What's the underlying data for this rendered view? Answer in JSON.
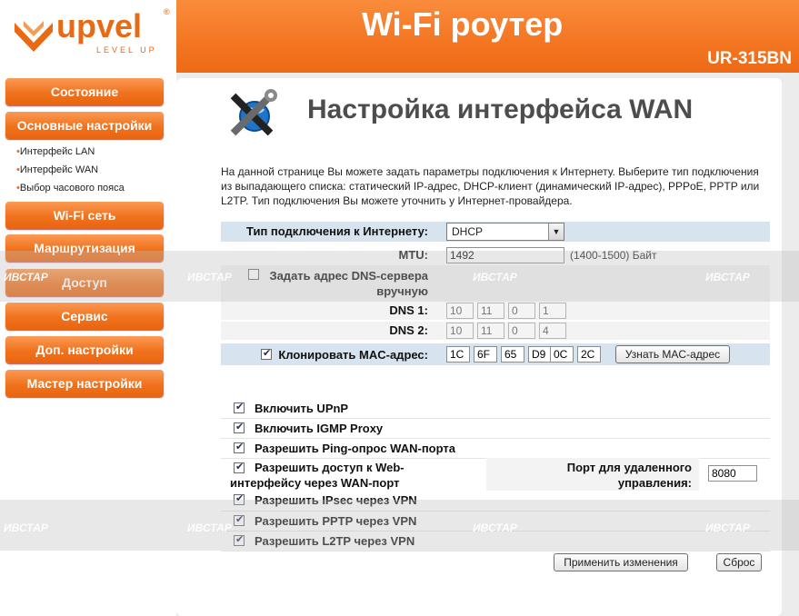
{
  "brand": {
    "name": "upvel",
    "tagline": "LEVEL UP",
    "reg": "®",
    "color": "#e86a14"
  },
  "header": {
    "title": "Wi-Fi роутер",
    "model": "UR-315BN",
    "color": "#f37521"
  },
  "sidebar": {
    "items": [
      {
        "label": "Состояние"
      },
      {
        "label": "Основные настройки"
      },
      {
        "label": "Wi-Fi сеть"
      },
      {
        "label": "Маршрутизация"
      },
      {
        "label": "Доступ"
      },
      {
        "label": "Сервис"
      },
      {
        "label": "Доп. настройки"
      },
      {
        "label": "Мастер настройки"
      }
    ],
    "subitems": [
      {
        "bullet": "•",
        "label": "Интерфейс LAN"
      },
      {
        "bullet": "•",
        "label": "Интерфейс WAN"
      },
      {
        "bullet": "•",
        "label": "Выбор часового пояса"
      }
    ]
  },
  "page": {
    "title": "Настройка интерфейса WAN",
    "icon": "tools-globe-icon",
    "description": "На данной странице Вы можете задать параметры подключения к Интернету. Выберите тип подключения из выпадающего списка: статический IP-адрес, DHCP-клиент (динамический IP-адрес), PPPoE, PPTP или L2TP. Тип подключения Вы можете уточнить у Интернет-провайдера."
  },
  "form": {
    "conn_type_label": "Тип подключения к Интернету:",
    "conn_type_value": "DHCP",
    "mtu_label": "MTU:",
    "mtu_value": "1492",
    "mtu_hint": "(1400-1500) Байт",
    "dns_manual_label": "Задать адрес DNS-сервера вручную",
    "dns_manual_checked": false,
    "dns1_label": "DNS 1:",
    "dns1": [
      "10",
      "11",
      "0",
      "1"
    ],
    "dns2_label": "DNS 2:",
    "dns2": [
      "10",
      "11",
      "0",
      "4"
    ],
    "clone_mac_label": "Клонировать MAC-адрес:",
    "clone_mac_checked": true,
    "mac": [
      "1C",
      "6F",
      "65",
      "D9",
      "0C",
      "2C"
    ],
    "find_mac_button": "Узнать MAC-адрес"
  },
  "options": [
    {
      "label": "Включить UPnP",
      "checked": true
    },
    {
      "label": "Включить IGMP Proxy",
      "checked": true
    },
    {
      "label": "Разрешить Ping-опрос WAN-порта",
      "checked": true
    },
    {
      "label": "Разрешить доступ к Web-интерфейсу через WAN-порт",
      "checked": true
    },
    {
      "label": "Разрешить IPsec через VPN",
      "checked": true
    },
    {
      "label": "Разрешить PPTP через VPN",
      "checked": true
    },
    {
      "label": "Разрешить L2TP через VPN",
      "checked": true
    }
  ],
  "remote": {
    "label": "Порт для удаленного управления:",
    "value": "8080"
  },
  "buttons": {
    "apply": "Применить изменения",
    "reset": "Сброс"
  },
  "watermark": "ИВСТАР"
}
